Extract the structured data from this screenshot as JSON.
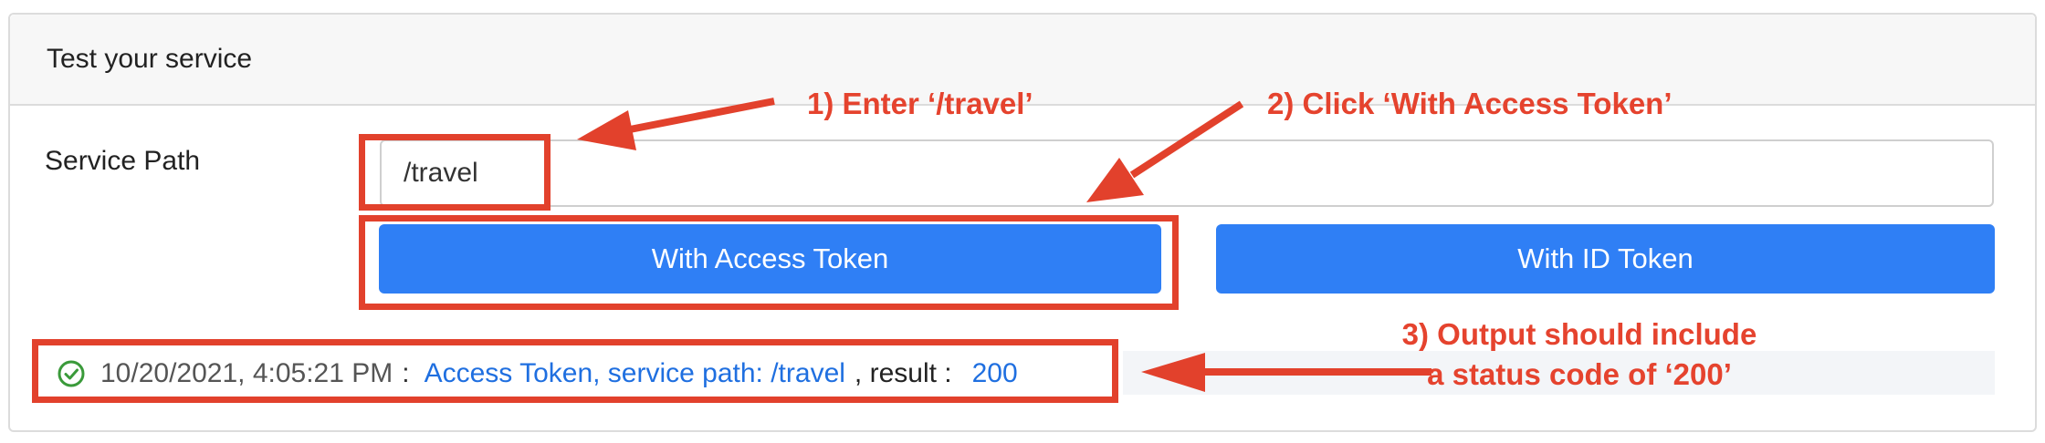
{
  "card": {
    "title": "Test your service"
  },
  "form": {
    "service_path_label": "Service Path",
    "service_path_value": "/travel"
  },
  "buttons": {
    "access_token_label": "With Access Token",
    "id_token_label": "With ID Token"
  },
  "result": {
    "status_icon": "check-circle-icon",
    "timestamp": "10/20/2021, 4:05:21 PM",
    "separator": ":",
    "message": "Access Token, service path: /travel",
    "result_label": ", result :",
    "status_code": "200"
  },
  "annotations": {
    "step1": "1) Enter ‘/travel’",
    "step2": "2) Click ‘With Access Token’",
    "step3_line1": "3) Output should include",
    "step3_line2": "a status code of ‘200’"
  },
  "colors": {
    "accent": "#2f7ff5",
    "annotation": "#e2412c",
    "success": "#3a9a3a",
    "link": "#1f6fe0"
  }
}
